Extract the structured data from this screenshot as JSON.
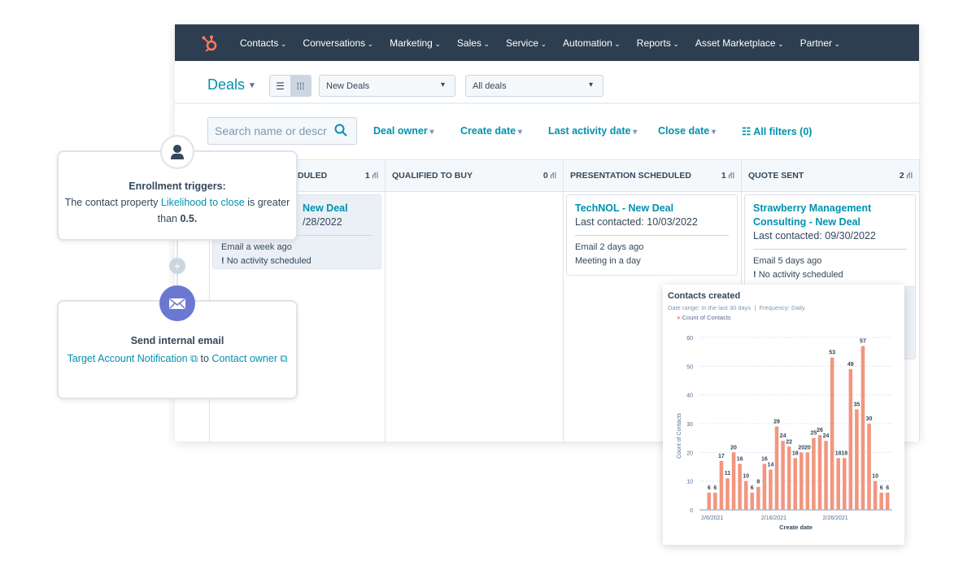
{
  "nav": {
    "items": [
      "Contacts",
      "Conversations",
      "Marketing",
      "Sales",
      "Service",
      "Automation",
      "Reports",
      "Asset Marketplace",
      "Partner"
    ],
    "brand_color": "#ff7a59",
    "bg_color": "#2d3e50"
  },
  "header": {
    "title": "Deals",
    "pipeline_select": "New Deals",
    "view_select": "All deals"
  },
  "filters": {
    "search_placeholder": "Search name or descr",
    "deal_owner": "Deal owner",
    "create_date": "Create date",
    "last_activity": "Last activity date",
    "close_date": "Close date",
    "all_filters": "All filters (0)"
  },
  "board": {
    "columns": [
      {
        "name": "DULED",
        "count": "1",
        "cards": [
          {
            "title": "New Deal",
            "last": "/28/2022",
            "s1": "Email a week ago",
            "s2": "No activity scheduled"
          }
        ]
      },
      {
        "name": "QUALIFIED TO BUY",
        "count": "0",
        "cards": []
      },
      {
        "name": "PRESENTATION SCHEDULED",
        "count": "1",
        "cards": [
          {
            "title": "TechNOL - New Deal",
            "last": "Last contacted: 10/03/2022",
            "s1": "Email 2 days ago",
            "s2": "Meeting in a day"
          }
        ]
      },
      {
        "name": "QUOTE SENT",
        "count": "2",
        "cards": [
          {
            "title": "Strawberry Management Consulting - New Deal",
            "last": "Last contacted: 09/30/2022",
            "s1": "Email 5 days ago",
            "s2": "No activity scheduled"
          }
        ]
      }
    ]
  },
  "workflow": {
    "trigger": {
      "title": "Enrollment triggers:",
      "pre": "The contact property",
      "link": "Likelihood to close",
      "mid": "is greater than",
      "value": "0.5."
    },
    "action": {
      "title": "Send internal email",
      "link1": "Target Account Notification",
      "mid": "to",
      "link2": "Contact owner"
    },
    "accent": "#6a78d1"
  },
  "chart_data": {
    "type": "bar",
    "title": "Contacts created",
    "subtitle_range": "Date range: In the last 30 days",
    "subtitle_freq": "Frequency: Daily",
    "legend": "Count of Contacts",
    "xlabel": "Create date",
    "ylabel": "Count of Contacts",
    "color": "#f2967f",
    "ylim": [
      0,
      60
    ],
    "yticks": [
      0,
      10,
      20,
      30,
      40,
      50,
      60
    ],
    "xticks": [
      "2/6/2021",
      "2/16/2021",
      "2/26/2021"
    ],
    "categories": [
      "2/6",
      "2/7",
      "2/8",
      "2/9",
      "2/10",
      "2/11",
      "2/12",
      "2/13",
      "2/14",
      "2/15",
      "2/16",
      "2/17",
      "2/18",
      "2/19",
      "2/20",
      "2/21",
      "2/22",
      "2/23",
      "2/24",
      "2/25",
      "2/26",
      "2/27",
      "2/28",
      "3/1",
      "3/2",
      "3/3",
      "3/4",
      "3/5",
      "3/6",
      "3/7"
    ],
    "values": [
      6,
      6,
      17,
      11,
      20,
      16,
      10,
      6,
      8,
      16,
      14,
      29,
      24,
      22,
      18,
      20,
      20,
      25,
      26,
      24,
      53,
      18,
      18,
      49,
      35,
      57,
      30,
      10,
      6,
      6
    ],
    "grid": true
  }
}
